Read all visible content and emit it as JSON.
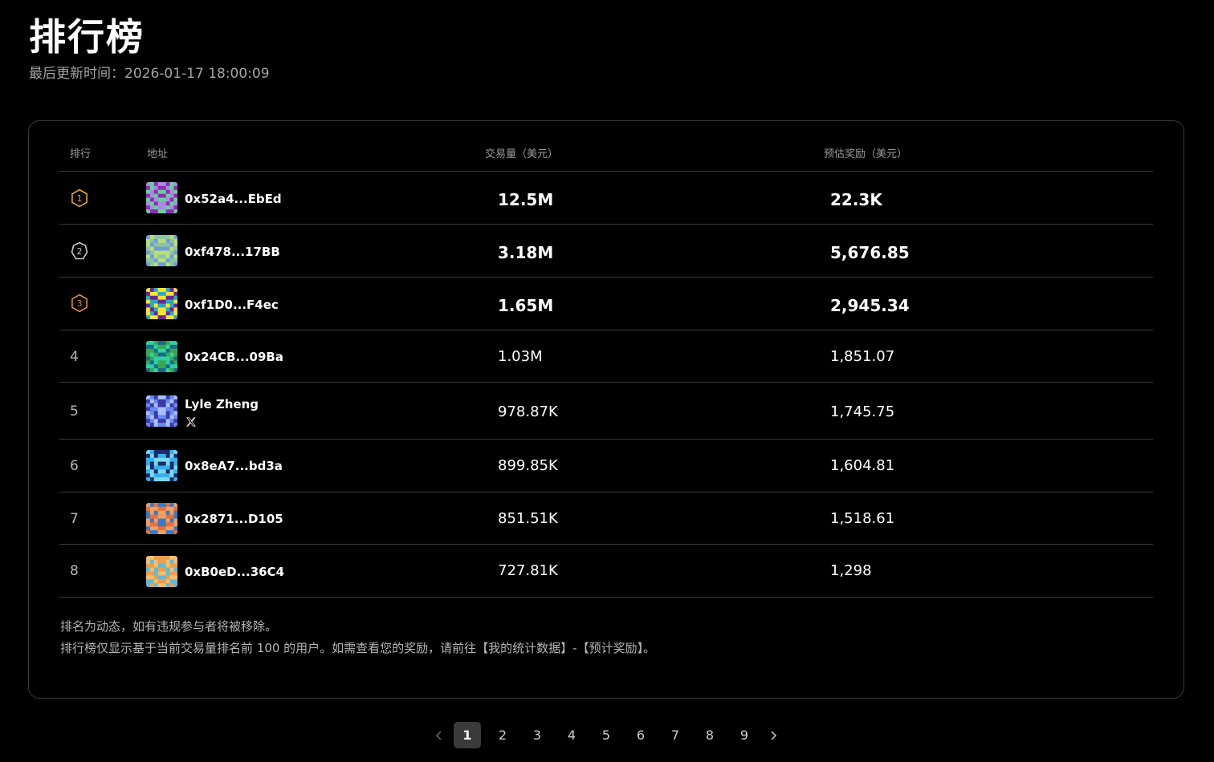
{
  "header": {
    "title": "排行榜",
    "updated": "最后更新时间：2026-01-17 18:00:09"
  },
  "table": {
    "columns": {
      "rank": "排行",
      "address": "地址",
      "volume": "交易量（美元）",
      "reward": "预估奖励（美元）"
    },
    "rows": [
      {
        "rank": "1",
        "address": "0x52a4...EbEd",
        "volume": "12.5M",
        "reward": "22.3K",
        "badge_color": "#e7a621"
      },
      {
        "rank": "2",
        "address": "0xf478...17BB",
        "volume": "3.18M",
        "reward": "5,676.85",
        "badge_color": "#c9c9c9"
      },
      {
        "rank": "3",
        "address": "0xf1D0...F4ec",
        "volume": "1.65M",
        "reward": "2,945.34",
        "badge_color": "#dd8a45"
      },
      {
        "rank": "4",
        "address": "0x24CB...09Ba",
        "volume": "1.03M",
        "reward": "1,851.07"
      },
      {
        "rank": "5",
        "address": "Lyle Zheng",
        "social_icon": "x-icon",
        "volume": "978.87K",
        "reward": "1,745.75"
      },
      {
        "rank": "6",
        "address": "0x8eA7...bd3a",
        "volume": "899.85K",
        "reward": "1,604.81"
      },
      {
        "rank": "7",
        "address": "0x2871...D105",
        "volume": "851.51K",
        "reward": "1,518.61"
      },
      {
        "rank": "8",
        "address": "0xB0eD...36C4",
        "volume": "727.81K",
        "reward": "1,298"
      }
    ]
  },
  "notes": {
    "line1": "排名为动态，如有违规参与者将被移除。",
    "line2": "排行榜仅显示基于当前交易量排名前 100 的用户。如需查看您的奖励，请前往【我的统计数据】-【预计奖励】。"
  },
  "pagination": {
    "pages": [
      "1",
      "2",
      "3",
      "4",
      "5",
      "6",
      "7",
      "8",
      "9"
    ],
    "current": "1"
  }
}
